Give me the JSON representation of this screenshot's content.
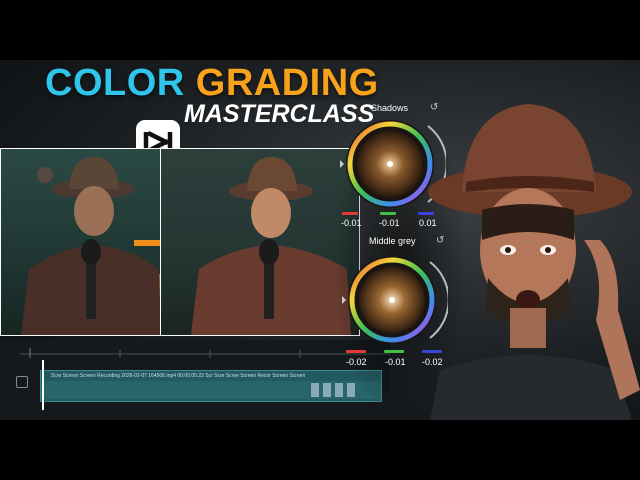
{
  "title": {
    "word1": "COLOR",
    "word2": "GRADING",
    "subtitle": "MASTERCLASS"
  },
  "color_panel": {
    "shadows": {
      "label": "Shadows",
      "values": [
        "-0.01",
        "-0.01",
        "0.01"
      ]
    },
    "middle_grey": {
      "label": "Middle grey",
      "values": [
        "-0.02",
        "-0.01",
        "-0.02"
      ]
    }
  },
  "timeline": {
    "clip_text": "Scre Screen Screen Recording 2026-02-07 164506.mp4 00:00:05:22  Scr Scre Scree Screen Recor Screen Screen"
  },
  "colors": {
    "title_blue": "#2fc4ea",
    "title_orange": "#f7a21a",
    "arrow": "#f28c1c",
    "red": "#e53935",
    "green": "#43c142",
    "blue": "#3b43d9"
  },
  "icons": [
    "capcut-logo-icon",
    "arrow-right-icon",
    "reset-icon",
    "microphone-icon"
  ]
}
